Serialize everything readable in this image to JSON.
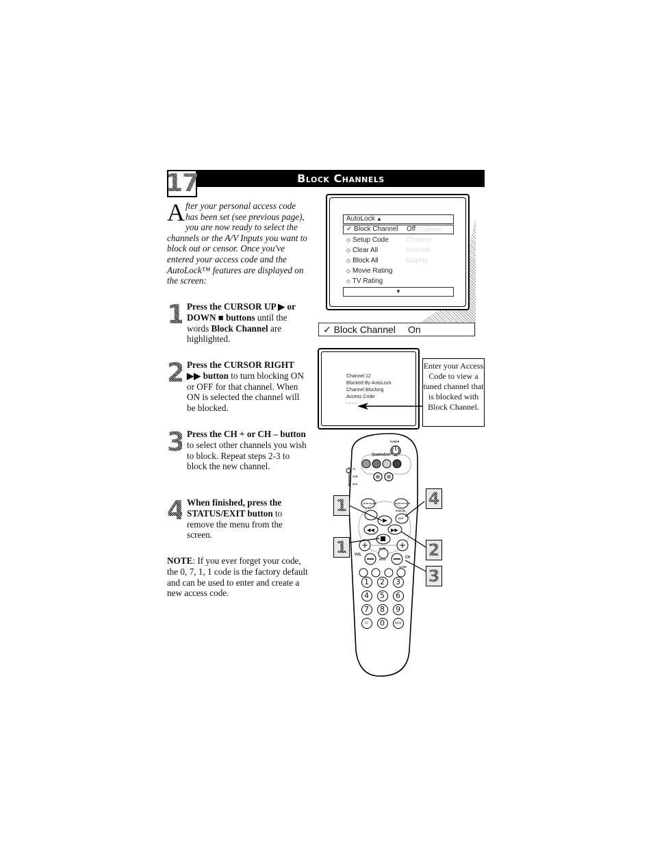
{
  "header": {
    "page_number": "17",
    "title": "Block Channels"
  },
  "intro": {
    "drop_cap": "A",
    "text": "fter your personal access code has been set (see previous page), you are now ready to select the channels or the A/V Inputs you want to block out or censor. Once you've entered your access code and the AutoLock™ features are displayed on the screen:"
  },
  "steps": [
    {
      "number": "1",
      "bold": "Press the CURSOR UP ▶ or DOWN ■ buttons",
      "text": " until the words ",
      "bold2": "Block Channel",
      "text2": " are highlighted."
    },
    {
      "number": "2",
      "bold": "Press the CURSOR RIGHT ▶▶ button",
      "text": " to turn blocking ON or OFF for that channel. When ON is selected the channel will be blocked.",
      "bold2": "",
      "text2": ""
    },
    {
      "number": "3",
      "bold": "Press the CH + or CH – button",
      "text": " to select other channels you wish to block. Repeat steps 2-3 to block the new channel.",
      "bold2": "",
      "text2": ""
    },
    {
      "number": "4",
      "bold": "When finished, press the STATUS/EXIT button",
      "text": " to remove the menu from the screen.",
      "bold2": "",
      "text2": ""
    }
  ],
  "note": {
    "label": "NOTE",
    "text": ": If you ever forget your code, the 0, 7, 1, 1 code is the factory default and can be used to enter and create a new access code."
  },
  "tv_menu": {
    "header": "AutoLock",
    "up_arrow": "▲",
    "down_arrow": "▼",
    "selected": {
      "check": "✓",
      "label": "Block Channel",
      "value": "Off"
    },
    "items": [
      {
        "bullet": "◇",
        "label": "Setup Code"
      },
      {
        "bullet": "◇",
        "label": "Clear All"
      },
      {
        "bullet": "◇",
        "label": "Block All"
      },
      {
        "bullet": "◇",
        "label": "Movie Rating"
      },
      {
        "bullet": "◇",
        "label": "TV Rating"
      }
    ],
    "faint_values": [
      "Channel",
      "Channel",
      "Activate",
      "Display"
    ],
    "zoomed_row": {
      "check": "✓",
      "label": "Block Channel",
      "value": "On"
    }
  },
  "tv_blocked": {
    "lines": [
      "Channel 12",
      "Blocked By AutoLock",
      "Channel Blocking",
      "Access Code",
      "- - - -"
    ]
  },
  "callout": {
    "text": "Enter your Access Code to view a tuned channel that is blocked with Block Channel."
  },
  "remote": {
    "power_label": "POWER",
    "brand": "QuadraSurf",
    "mode_labels": [
      "TV",
      "VCR",
      "ACC"
    ],
    "button_labels": {
      "auto_sound": "AUTO SOUND",
      "auto_picture": "AUTO PICTURE",
      "status": "STATUS",
      "exit": "EXIT",
      "vol": "VOL",
      "ch": "CH",
      "mute": "MUTE",
      "surf": "SURF",
      "sleep": "SLEEP",
      "cc": "CC",
      "a_ch": "A/CH"
    },
    "digits": [
      "1",
      "2",
      "3",
      "4",
      "5",
      "6",
      "7",
      "8",
      "9",
      "0"
    ],
    "callouts": [
      "1",
      "4",
      "1",
      "2",
      "3"
    ]
  }
}
